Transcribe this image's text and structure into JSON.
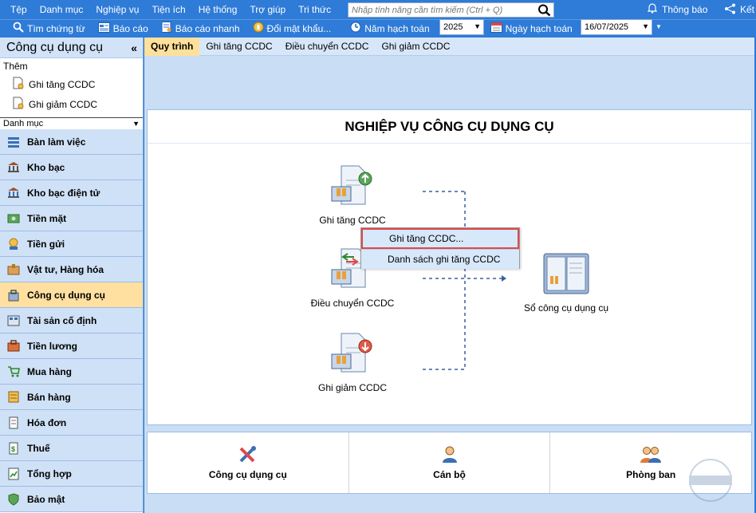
{
  "menubar": {
    "items": [
      "Tệp",
      "Danh mục",
      "Nghiệp vụ",
      "Tiện ích",
      "Hệ thống",
      "Trợ giúp",
      "Tri thức"
    ],
    "search_placeholder": "Nhập tính năng cần tìm kiếm (Ctrl + Q)",
    "notify_label": "Thông báo",
    "connect_label": "Kết"
  },
  "toolbar": {
    "find_voucher": "Tìm chứng từ",
    "report": "Báo cáo",
    "quick_report": "Báo cáo nhanh",
    "change_password": "Đổi mật khẩu...",
    "fiscal_year_label": "Năm hạch toán",
    "fiscal_year_value": "2025",
    "posting_date_label": "Ngày hạch toán",
    "posting_date_value": "16/07/2025"
  },
  "sidebar": {
    "title": "Công cụ dụng cụ",
    "collapse": "«",
    "add_label": "Thêm",
    "links": [
      "Ghi tăng CCDC",
      "Ghi giảm CCDC"
    ],
    "category_label": "Danh mục",
    "nav": [
      {
        "label": "Bàn làm việc",
        "icon": "desk-icon"
      },
      {
        "label": "Kho bạc",
        "icon": "treasury-icon"
      },
      {
        "label": "Kho bạc điện tử",
        "icon": "e-treasury-icon"
      },
      {
        "label": "Tiền mặt",
        "icon": "cash-icon"
      },
      {
        "label": "Tiền gửi",
        "icon": "deposit-icon"
      },
      {
        "label": "Vật tư, Hàng hóa",
        "icon": "goods-icon"
      },
      {
        "label": "Công cụ dụng cụ",
        "icon": "tools-icon"
      },
      {
        "label": "Tài sản cố định",
        "icon": "fixed-asset-icon"
      },
      {
        "label": "Tiền lương",
        "icon": "salary-icon"
      },
      {
        "label": "Mua hàng",
        "icon": "purchase-icon"
      },
      {
        "label": "Bán hàng",
        "icon": "sales-icon"
      },
      {
        "label": "Hóa đơn",
        "icon": "invoice-icon"
      },
      {
        "label": "Thuế",
        "icon": "tax-icon"
      },
      {
        "label": "Tổng hợp",
        "icon": "summary-icon"
      },
      {
        "label": "Bảo mật",
        "icon": "security-icon"
      }
    ]
  },
  "tabs": [
    "Quy trình",
    "Ghi tăng CCDC",
    "Điều chuyển CCDC",
    "Ghi giảm CCDC"
  ],
  "workflow": {
    "title": "NGHIỆP VỤ CÔNG CỤ DỤNG CỤ",
    "increase": "Ghi tăng CCDC",
    "transfer": "Điều chuyển CCDC",
    "decrease": "Ghi giảm CCDC",
    "ledger": "Sổ công cụ dụng cụ"
  },
  "context_menu": [
    "Ghi tăng CCDC...",
    "Danh sách ghi tăng CCDC"
  ],
  "bottom_panel": [
    "Công cụ dụng cụ",
    "Cán bộ",
    "Phòng ban"
  ],
  "colors": {
    "bar_blue": "#2e7bd8",
    "active_tab": "#ffe09a",
    "highlight_border": "#e04848"
  }
}
